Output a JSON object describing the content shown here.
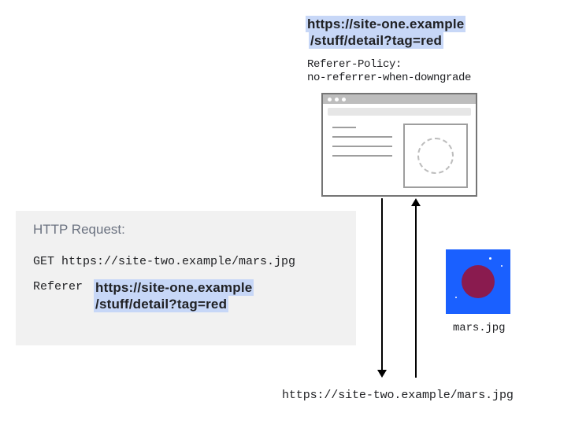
{
  "top_url": {
    "line1": "https://site-one.example",
    "line2": "/stuff/detail?tag=red"
  },
  "policy": {
    "header": "Referer-Policy:",
    "value": "no-referrer-when-downgrade"
  },
  "request": {
    "title": "HTTP Request:",
    "get_line": "GET https://site-two.example/mars.jpg",
    "referer_label": "Referer",
    "referer_value": {
      "line1": "https://site-one.example",
      "line2": "/stuff/detail?tag=red"
    }
  },
  "mars_caption": "mars.jpg",
  "bottom_url": "https://site-two.example/mars.jpg"
}
